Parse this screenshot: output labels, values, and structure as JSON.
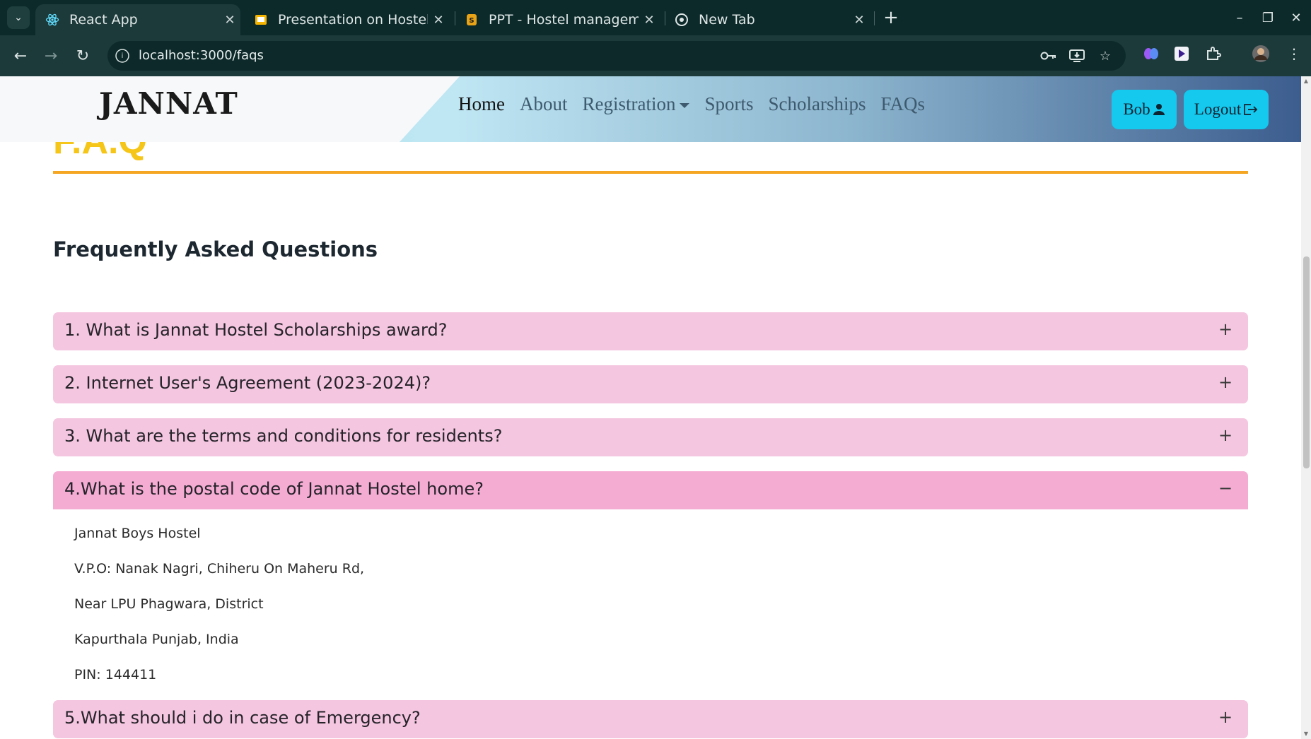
{
  "browser": {
    "tabs": [
      {
        "label": "React App",
        "icon": "react-icon",
        "active": true
      },
      {
        "label": "Presentation on Hostel Management",
        "icon": "slides-icon",
        "active": false
      },
      {
        "label": "PPT - Hostel management",
        "icon": "slideshare-icon",
        "active": false
      },
      {
        "label": "New Tab",
        "icon": "chrome-icon",
        "active": false
      }
    ],
    "url": "localhost:3000/faqs"
  },
  "navbar": {
    "brand": "JANNAT",
    "links": [
      "Home",
      "About",
      "Registration",
      "Sports",
      "Scholarships",
      "FAQs"
    ],
    "user_label": "Bob",
    "logout_label": "Logout"
  },
  "page": {
    "heading": "F.A.Q",
    "subheading": "Frequently Asked Questions",
    "faqs": [
      {
        "question": "1. What is Jannat Hostel Scholarships award?",
        "toggle": "+"
      },
      {
        "question": "2. Internet User's Agreement (2023-2024)?",
        "toggle": "+"
      },
      {
        "question": "3. What are the terms and conditions for residents?",
        "toggle": "+"
      },
      {
        "question": "4.What is the postal code of Jannat Hostel home?",
        "toggle": "−",
        "answer": [
          "Jannat Boys Hostel",
          "V.P.O: Nanak Nagri, Chiheru On Maheru Rd,",
          "Near LPU Phagwara, District",
          "Kapurthala Punjab, India",
          "PIN: 144411"
        ]
      },
      {
        "question": "5.What should i do in case of Emergency?",
        "toggle": "+"
      }
    ]
  },
  "colors": {
    "accent_yellow": "#f5c518",
    "rule_orange": "#f5a623",
    "faq_closed": "#f5c6e0",
    "faq_open": "#f5acd3",
    "button_cyan": "#14c8ee"
  }
}
